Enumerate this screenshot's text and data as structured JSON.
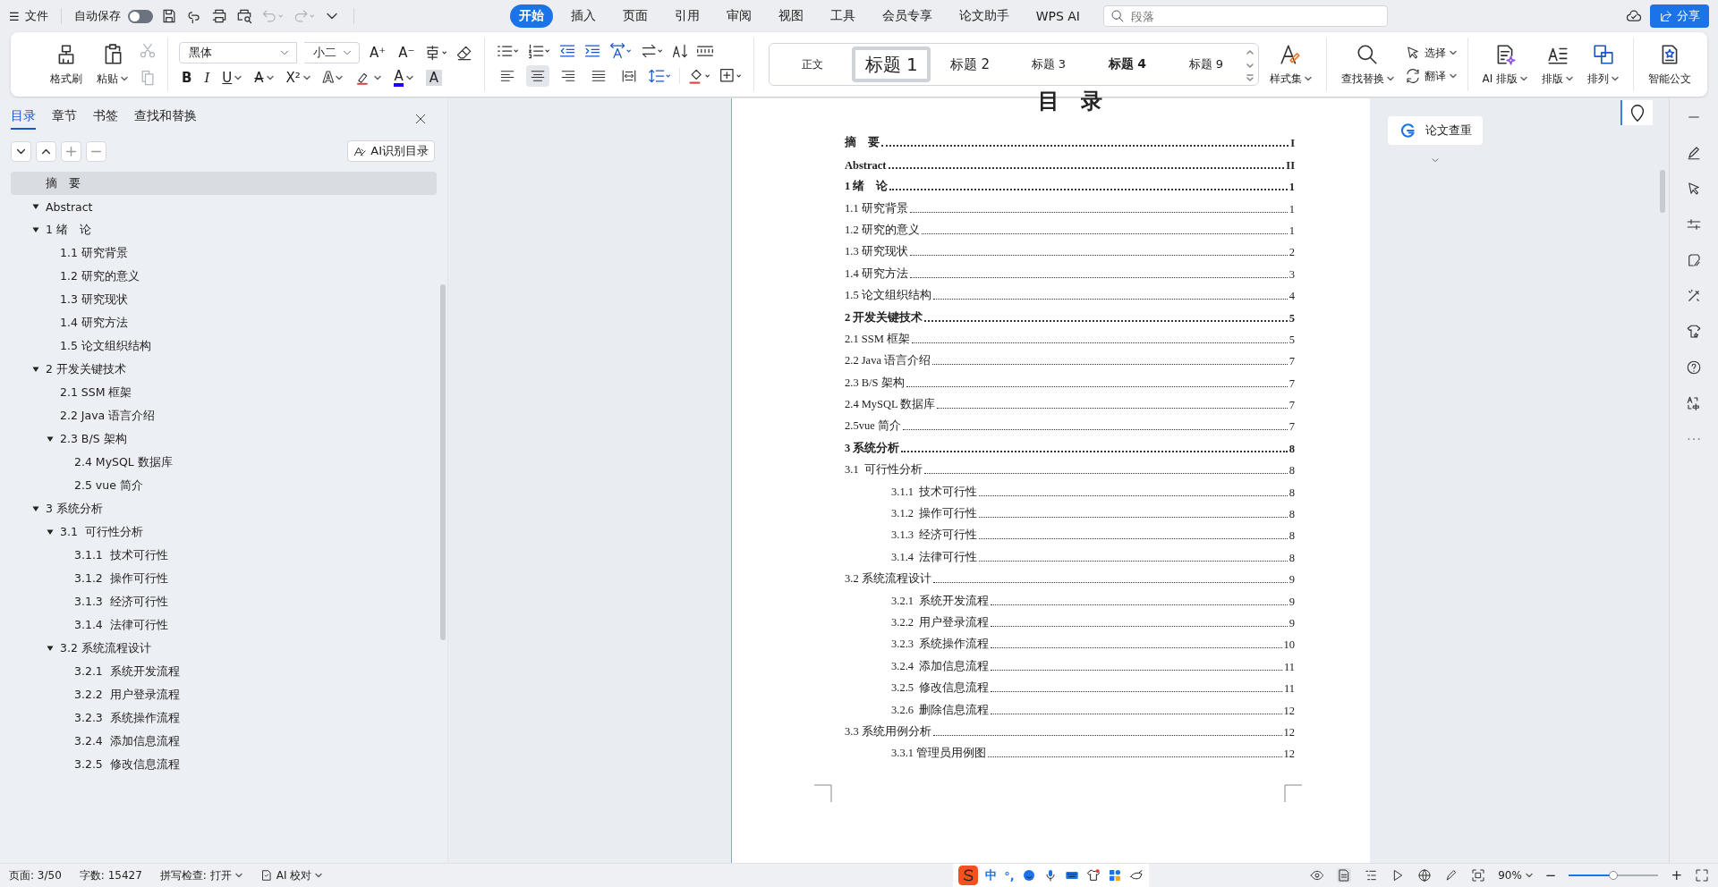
{
  "menu_bar": {
    "file_menu": {
      "icon": "☰",
      "label": "文件"
    },
    "autosave": {
      "label": "自动保存",
      "on": false
    },
    "undo": {
      "disabled": true
    },
    "redo": {
      "disabled": true
    },
    "tabs": [
      {
        "label": "开始",
        "selected": true
      },
      {
        "label": "插入",
        "selected": false
      },
      {
        "label": "页面",
        "selected": false
      },
      {
        "label": "引用",
        "selected": false
      },
      {
        "label": "审阅",
        "selected": false
      },
      {
        "label": "视图",
        "selected": false
      },
      {
        "label": "工具",
        "selected": false
      },
      {
        "label": "会员专享",
        "selected": false
      },
      {
        "label": "论文助手",
        "selected": false
      },
      {
        "label": "WPS AI",
        "selected": false
      }
    ],
    "search": {
      "placeholder": "段落"
    },
    "share_button": "分享"
  },
  "ribbon": {
    "clipboard": {
      "format_painter": "格式刷",
      "paste": "粘贴",
      "cut": {
        "disabled": true
      },
      "copy": {
        "disabled": true
      }
    },
    "font": {
      "name": "黑体",
      "size": "小二",
      "size_tools": [
        "A⁺",
        "A⁻"
      ],
      "format_buttons": [
        {
          "kind": "bold",
          "label": "B",
          "dropdown": false
        },
        {
          "kind": "italic",
          "label": "I",
          "dropdown": false
        },
        {
          "kind": "underline",
          "label": "U",
          "dropdown": true
        },
        {
          "kind": "strike",
          "label": "A",
          "dropdown": true
        },
        {
          "kind": "superscript",
          "label": "X²",
          "dropdown": true
        },
        {
          "kind": "effect",
          "label": "A",
          "dropdown": true
        },
        {
          "kind": "highlight",
          "dropdown": true
        },
        {
          "kind": "color",
          "label": "A",
          "dropdown": true
        },
        {
          "kind": "shade",
          "label": "A",
          "dropdown": false
        }
      ]
    },
    "paragraph": {
      "align_options": [
        {
          "kind": "left",
          "selected": false
        },
        {
          "kind": "center",
          "selected": true
        },
        {
          "kind": "right",
          "selected": false
        },
        {
          "kind": "justify",
          "selected": false
        },
        {
          "kind": "distributed",
          "selected": false
        }
      ]
    },
    "styles": [
      {
        "label": "正文",
        "kind": "body",
        "selected": false
      },
      {
        "label": "标题 1",
        "kind": "h1",
        "selected": true
      },
      {
        "label": "标题 2",
        "kind": "h2",
        "selected": false
      },
      {
        "label": "标题 3",
        "kind": "h3",
        "selected": false
      },
      {
        "label": "标题 4",
        "kind": "h4",
        "selected": false
      },
      {
        "label": "标题 9",
        "kind": "h9",
        "selected": false
      }
    ],
    "style_set": "样式集",
    "find_replace": "查找替换",
    "select": "选择",
    "translate": "翻译",
    "ai_layout": "AI 排版",
    "layout": "排版",
    "arrange": "排列",
    "smart_doc": "智能公文"
  },
  "sidebar": {
    "tabs": [
      {
        "label": "目录",
        "selected": true
      },
      {
        "label": "章节",
        "selected": false
      },
      {
        "label": "书签",
        "selected": false
      },
      {
        "label": "查找和替换",
        "selected": false
      }
    ],
    "ai_button": "AI识别目录",
    "outline": [
      {
        "label": "摘　要",
        "selected": true,
        "expanded": false
      },
      {
        "label": "Abstract",
        "selected": false,
        "expanded": true
      },
      {
        "label": "1 绪　论",
        "selected": false,
        "expanded": true,
        "children": [
          {
            "label": "1.1 研究背景",
            "selected": false,
            "expanded": false
          },
          {
            "label": "1.2 研究的意义",
            "selected": false,
            "expanded": false
          },
          {
            "label": "1.3 研究现状",
            "selected": false,
            "expanded": false
          },
          {
            "label": "1.4 研究方法",
            "selected": false,
            "expanded": false
          },
          {
            "label": "1.5 论文组织结构",
            "selected": false,
            "expanded": false
          }
        ]
      },
      {
        "label": "2 开发关键技术",
        "selected": false,
        "expanded": true,
        "children": [
          {
            "label": "2.1 SSM 框架",
            "selected": false,
            "expanded": false
          },
          {
            "label": "2.2 Java 语言介绍",
            "selected": false,
            "expanded": false
          },
          {
            "label": "2.3 B/S 架构",
            "selected": false,
            "expanded": true,
            "children": [
              {
                "label": "2.4 MySQL 数据库",
                "selected": false,
                "expanded": false
              },
              {
                "label": "2.5 vue 简介",
                "selected": false,
                "expanded": false
              }
            ]
          }
        ]
      },
      {
        "label": "3 系统分析",
        "selected": false,
        "expanded": true,
        "children": [
          {
            "label": "3.1  可行性分析",
            "selected": false,
            "expanded": true,
            "children": [
              {
                "label": "3.1.1  技术可行性",
                "selected": false,
                "expanded": false
              },
              {
                "label": "3.1.2  操作可行性",
                "selected": false,
                "expanded": false
              },
              {
                "label": "3.1.3  经济可行性",
                "selected": false,
                "expanded": false
              },
              {
                "label": "3.1.4  法律可行性",
                "selected": false,
                "expanded": false
              }
            ]
          },
          {
            "label": "3.2 系统流程设计",
            "selected": false,
            "expanded": true,
            "children": [
              {
                "label": "3.2.1  系统开发流程",
                "selected": false,
                "expanded": false
              },
              {
                "label": "3.2.2  用户登录流程",
                "selected": false,
                "expanded": false
              },
              {
                "label": "3.2.3  系统操作流程",
                "selected": false,
                "expanded": false
              },
              {
                "label": "3.2.4  添加信息流程",
                "selected": false,
                "expanded": false
              },
              {
                "label": "3.2.5  修改信息流程",
                "selected": false,
                "expanded": false
              }
            ]
          }
        ]
      }
    ]
  },
  "document": {
    "title": "目　录",
    "toc": [
      {
        "text": "摘　要",
        "page": "I",
        "kind": "chapter"
      },
      {
        "text": "Abstract",
        "page": "II",
        "kind": "chapter"
      },
      {
        "text": "1 绪　论",
        "page": "1",
        "kind": "chapter"
      },
      {
        "text": "1.1 研究背景",
        "page": "1",
        "kind": "section"
      },
      {
        "text": "1.2 研究的意义",
        "page": "1",
        "kind": "section"
      },
      {
        "text": "1.3 研究现状",
        "page": "2",
        "kind": "section"
      },
      {
        "text": "1.4 研究方法",
        "page": "3",
        "kind": "section"
      },
      {
        "text": "1.5 论文组织结构",
        "page": "4",
        "kind": "section"
      },
      {
        "text": "2 开发关键技术",
        "page": "5",
        "kind": "chapter"
      },
      {
        "text": "2.1 SSM 框架",
        "page": "5",
        "kind": "section"
      },
      {
        "text": "2.2 Java 语言介绍",
        "page": "7",
        "kind": "section"
      },
      {
        "text": "2.3 B/S 架构",
        "page": "7",
        "kind": "section"
      },
      {
        "text": "2.4 MySQL 数据库",
        "page": "7",
        "kind": "section"
      },
      {
        "text": "2.5vue 简介",
        "page": "7",
        "kind": "section"
      },
      {
        "text": "3 系统分析",
        "page": "8",
        "kind": "chapter"
      },
      {
        "text": "3.1  可行性分析",
        "page": "8",
        "kind": "section"
      },
      {
        "text": "3.1.1  技术可行性",
        "page": "8",
        "kind": "subsection"
      },
      {
        "text": "3.1.2  操作可行性",
        "page": "8",
        "kind": "subsection"
      },
      {
        "text": "3.1.3  经济可行性",
        "page": "8",
        "kind": "subsection"
      },
      {
        "text": "3.1.4  法律可行性",
        "page": "8",
        "kind": "subsection"
      },
      {
        "text": "3.2 系统流程设计",
        "page": "9",
        "kind": "section"
      },
      {
        "text": "3.2.1  系统开发流程",
        "page": "9",
        "kind": "subsection"
      },
      {
        "text": "3.2.2  用户登录流程",
        "page": "9",
        "kind": "subsection"
      },
      {
        "text": "3.2.3  系统操作流程",
        "page": "10",
        "kind": "subsection"
      },
      {
        "text": "3.2.4  添加信息流程",
        "page": "11",
        "kind": "subsection"
      },
      {
        "text": "3.2.5  修改信息流程",
        "page": "11",
        "kind": "subsection"
      },
      {
        "text": "3.2.6  删除信息流程",
        "page": "12",
        "kind": "subsection"
      },
      {
        "text": "3.3 系统用例分析",
        "page": "12",
        "kind": "section"
      },
      {
        "text": "3.3.1 管理员用例图",
        "page": "12",
        "kind": "subsection"
      }
    ]
  },
  "side_panel": {
    "check_button": "论文查重"
  },
  "status_bar": {
    "page": "页面: 3/50",
    "words": "字数: 15427",
    "spell_check": "拼写检查: 打开",
    "ai_proofread": "AI 校对",
    "ime": [
      "中",
      "°,"
    ],
    "zoom": "90%",
    "zoom_out": "−",
    "zoom_in": "+",
    "zoom_slider": {
      "level": 0.5
    }
  }
}
